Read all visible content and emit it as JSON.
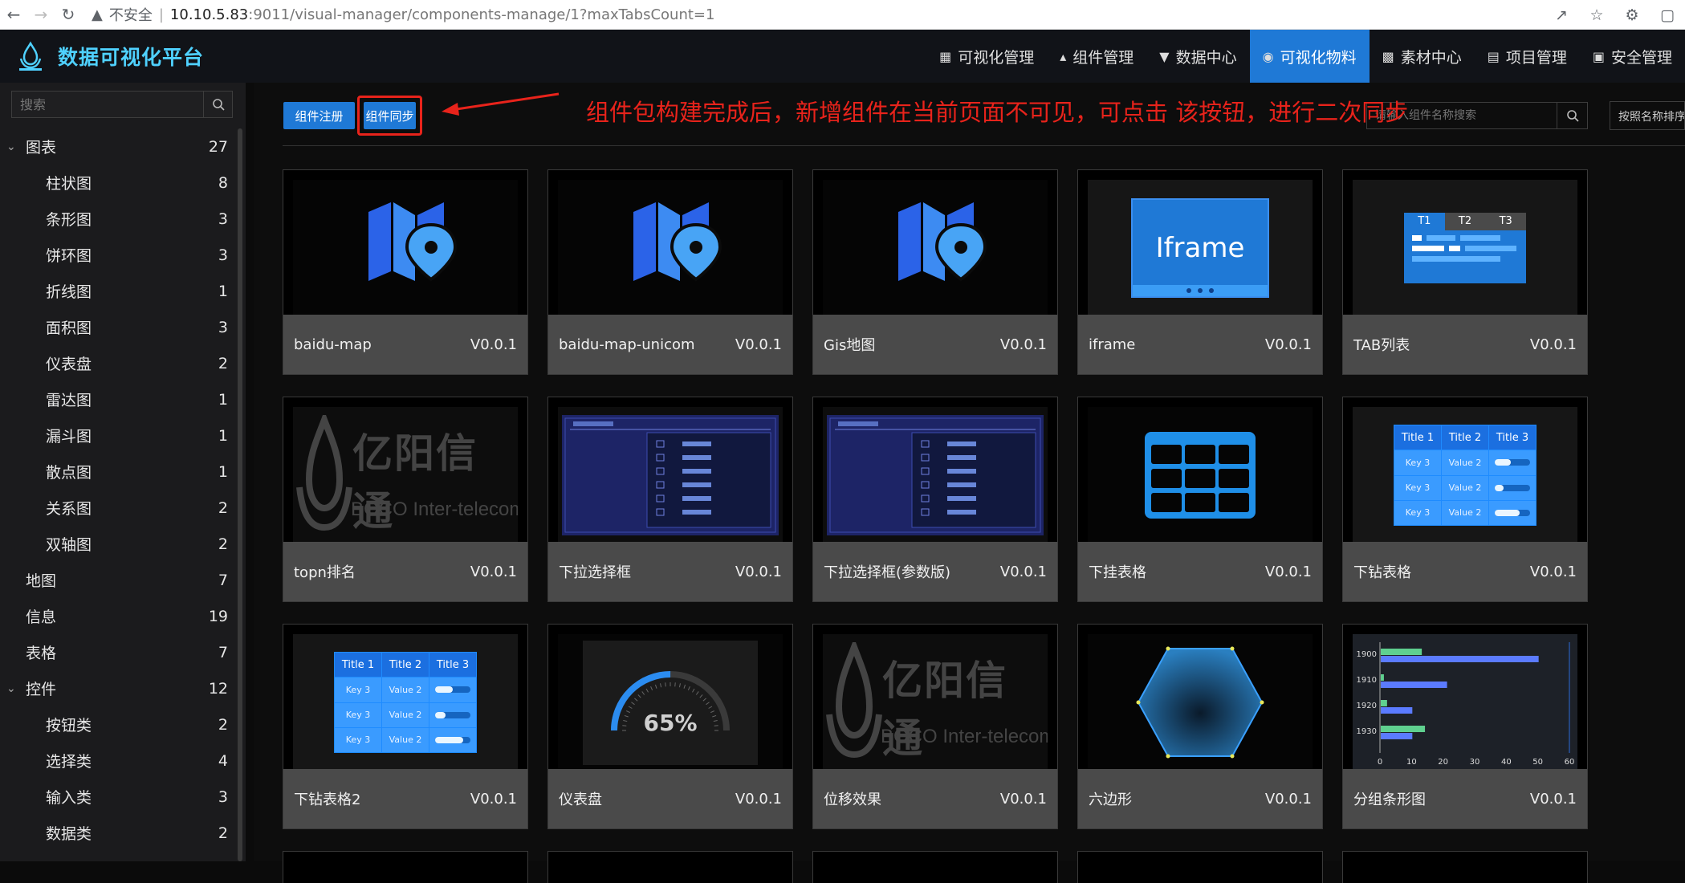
{
  "browser": {
    "insecure_label": "不安全",
    "url_host": "10.10.5.83",
    "url_rest": ":9011/visual-manager/components-manage/1?maxTabsCount=1"
  },
  "app": {
    "title": "数据可视化平台"
  },
  "top_nav": [
    {
      "label": "可视化管理",
      "icon": "grid-icon"
    },
    {
      "label": "组件管理",
      "icon": "hierarchy-icon"
    },
    {
      "label": "数据中心",
      "icon": "filter-icon"
    },
    {
      "label": "可视化物料",
      "icon": "gamepad-icon",
      "active": true
    },
    {
      "label": "素材中心",
      "icon": "image-icon"
    },
    {
      "label": "项目管理",
      "icon": "database-icon"
    },
    {
      "label": "安全管理",
      "icon": "monitor-icon"
    }
  ],
  "sidebar": {
    "search_placeholder": "搜索",
    "tree": [
      {
        "label": "图表",
        "count": "27",
        "type": "parent"
      },
      {
        "label": "柱状图",
        "count": "8",
        "type": "child"
      },
      {
        "label": "条形图",
        "count": "3",
        "type": "child"
      },
      {
        "label": "饼环图",
        "count": "3",
        "type": "child"
      },
      {
        "label": "折线图",
        "count": "1",
        "type": "child"
      },
      {
        "label": "面积图",
        "count": "3",
        "type": "child"
      },
      {
        "label": "仪表盘",
        "count": "2",
        "type": "child"
      },
      {
        "label": "雷达图",
        "count": "1",
        "type": "child"
      },
      {
        "label": "漏斗图",
        "count": "1",
        "type": "child"
      },
      {
        "label": "散点图",
        "count": "1",
        "type": "child"
      },
      {
        "label": "关系图",
        "count": "2",
        "type": "child"
      },
      {
        "label": "双轴图",
        "count": "2",
        "type": "child"
      },
      {
        "label": "地图",
        "count": "7",
        "type": "leaf-top"
      },
      {
        "label": "信息",
        "count": "19",
        "type": "leaf-top"
      },
      {
        "label": "表格",
        "count": "7",
        "type": "leaf-top"
      },
      {
        "label": "控件",
        "count": "12",
        "type": "parent"
      },
      {
        "label": "按钮类",
        "count": "2",
        "type": "child"
      },
      {
        "label": "选择类",
        "count": "4",
        "type": "child"
      },
      {
        "label": "输入类",
        "count": "3",
        "type": "child"
      },
      {
        "label": "数据类",
        "count": "2",
        "type": "child"
      }
    ]
  },
  "toolbar": {
    "register_label": "组件注册",
    "sync_label": "组件同步",
    "annotation": "组件包构建完成后，新增组件在当前页面不可见，可点击 该按钮，进行二次同步",
    "search_placeholder": "请输入组件名称搜索",
    "sort_label": "按照名称排序"
  },
  "cards": [
    {
      "name": "baidu-map",
      "version": "V0.0.1",
      "thumb": "map-pin"
    },
    {
      "name": "baidu-map-unicom",
      "version": "V0.0.1",
      "thumb": "map-pin"
    },
    {
      "name": "Gis地图",
      "version": "V0.0.1",
      "thumb": "map-pin"
    },
    {
      "name": "iframe",
      "version": "V0.0.1",
      "thumb": "iframe",
      "thumb_text": "Iframe"
    },
    {
      "name": "TAB列表",
      "version": "V0.0.1",
      "thumb": "tabs",
      "tabs": [
        "T1",
        "T2",
        "T3"
      ]
    },
    {
      "name": "topn排名",
      "version": "V0.0.1",
      "thumb": "logo",
      "logo_text": "亿阳信通",
      "logo_sub": "BOCO Inter-telecom"
    },
    {
      "name": "下拉选择框",
      "version": "V0.0.1",
      "thumb": "dropdown"
    },
    {
      "name": "下拉选择框(参数版)",
      "version": "V0.0.1",
      "thumb": "dropdown"
    },
    {
      "name": "下挂表格",
      "version": "V0.0.1",
      "thumb": "table-grid"
    },
    {
      "name": "下钻表格",
      "version": "V0.0.1",
      "thumb": "drill-table",
      "headers": [
        "Title 1",
        "Title 2",
        "Title 3"
      ],
      "cells": [
        [
          "Key 3",
          "Value 2"
        ],
        [
          "Key 3",
          "Value 2"
        ],
        [
          "Key 3",
          "Value 2"
        ]
      ],
      "fills": [
        0.45,
        0.25,
        0.7
      ]
    },
    {
      "name": "下钻表格2",
      "version": "V0.0.1",
      "thumb": "drill-table",
      "headers": [
        "Title 1",
        "Title 2",
        "Title 3"
      ],
      "cells": [
        [
          "Key 3",
          "Value 2"
        ],
        [
          "Key 3",
          "Value 2"
        ],
        [
          "Key 3",
          "Value 2"
        ]
      ],
      "fills": [
        0.5,
        0.3,
        0.8
      ]
    },
    {
      "name": "仪表盘",
      "version": "V0.0.1",
      "thumb": "gauge",
      "gauge_text": "65%",
      "gauge_value": 0.65
    },
    {
      "name": "位移效果",
      "version": "V0.0.1",
      "thumb": "logo",
      "logo_text": "亿阳信通",
      "logo_sub": "BOCO Inter-telecom"
    },
    {
      "name": "六边形",
      "version": "V0.0.1",
      "thumb": "hexagon"
    },
    {
      "name": "分组条形图",
      "version": "V0.0.1",
      "thumb": "group-bar"
    }
  ],
  "chart_data": {
    "type": "bar",
    "categories": [
      "1900",
      "1910",
      "1920",
      "1930"
    ],
    "series": [
      {
        "values": [
          13,
          1,
          2,
          14
        ]
      },
      {
        "values": [
          50,
          21,
          10,
          10
        ]
      }
    ],
    "xlim": [
      0,
      60
    ],
    "xticks": [
      "0",
      "10",
      "20",
      "30",
      "40",
      "50",
      "60"
    ],
    "colors": [
      "#5fd08f",
      "#5b7bff"
    ]
  }
}
